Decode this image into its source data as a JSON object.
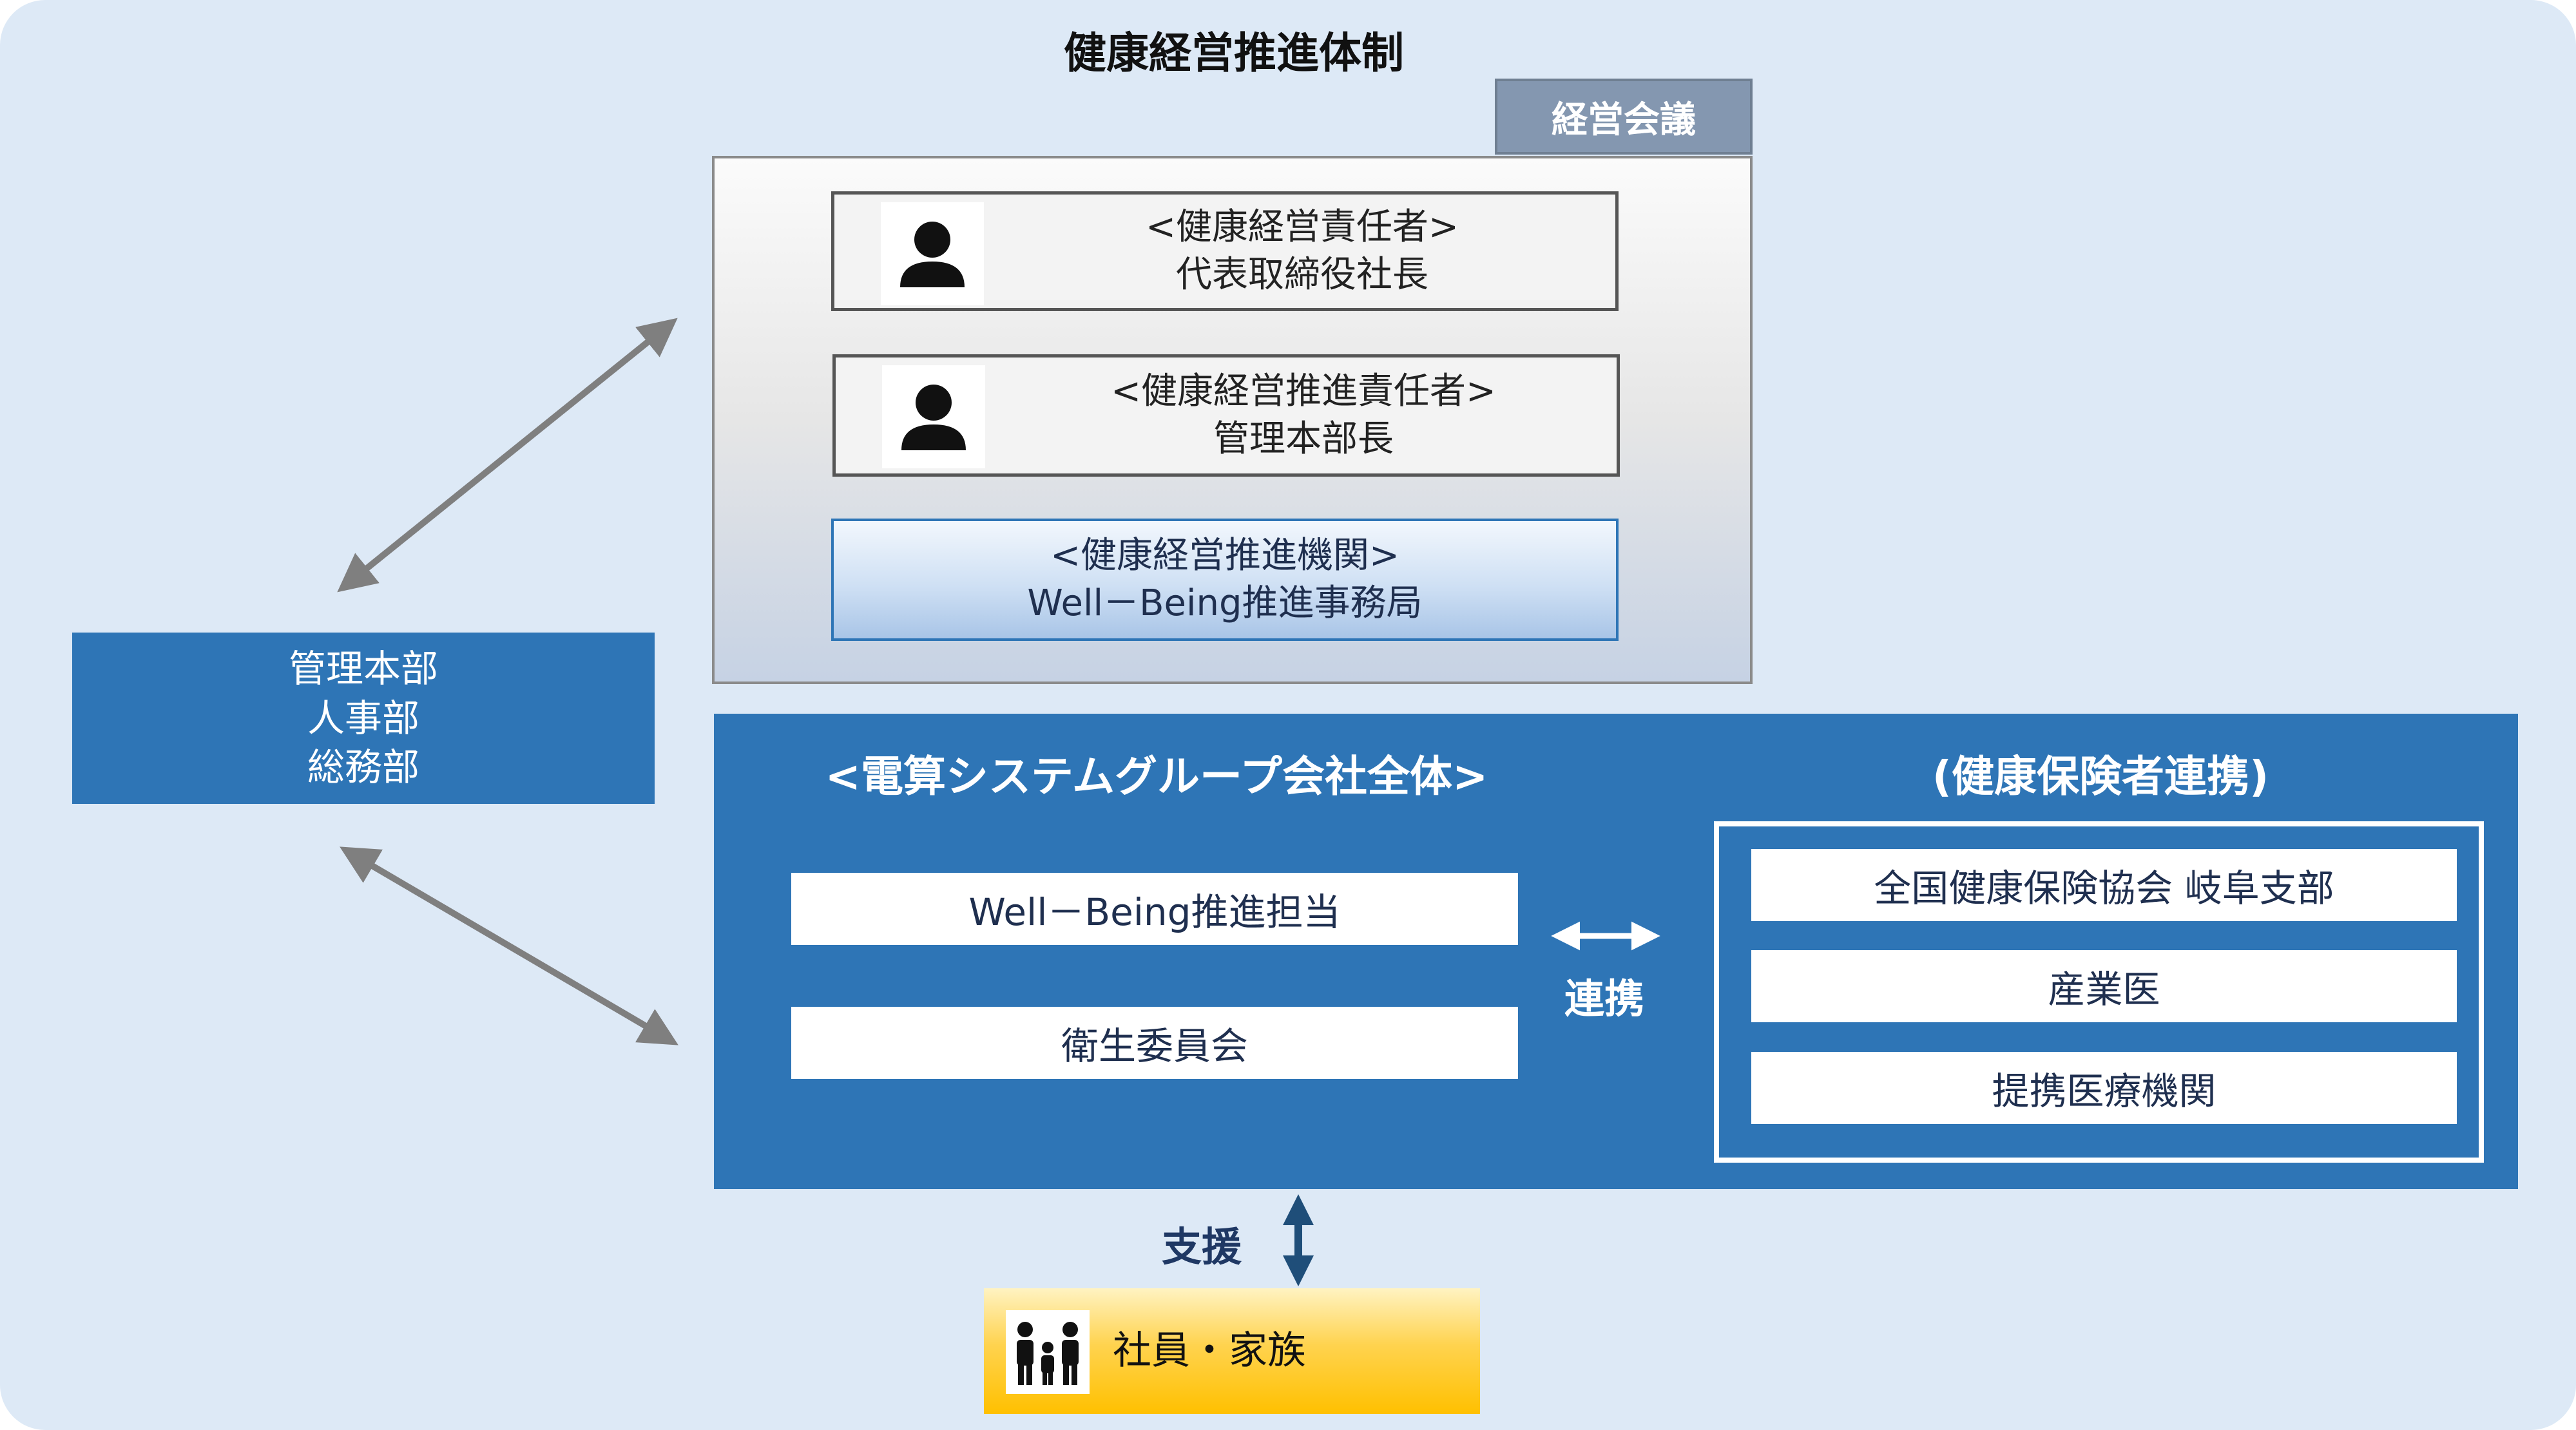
{
  "diagram": {
    "title": "健康経営推進体制",
    "meeting": {
      "label": "経営会議",
      "roles": [
        {
          "heading": "<健康経営責任者>",
          "name": "代表取締役社長",
          "icon": "person-icon"
        },
        {
          "heading": "<健康経営推進責任者>",
          "name": "管理本部長",
          "icon": "person-icon"
        }
      ],
      "promotion": {
        "heading": "<健康経営推進機関>",
        "name": "Well－Being推進事務局"
      }
    },
    "admin": {
      "lines": [
        "管理本部",
        "人事部",
        "総務部"
      ]
    },
    "group": {
      "title": "<電算システムグループ会社全体>",
      "items": [
        "Well－Being推進担当",
        "衛生委員会"
      ]
    },
    "insurer": {
      "title": "(健康保険者連携)",
      "items": [
        "全国健康保険協会 岐阜支部",
        "産業医",
        "提携医療機関"
      ]
    },
    "cooperation_label": "連携",
    "support_label": "支援",
    "family": {
      "label": "社員・家族",
      "icon": "family-icon"
    },
    "colors": {
      "background": "#dde9f6",
      "panel_blue": "#2e75b6",
      "meeting_tab": "#8497b0",
      "arrow_gray": "#7f7f7f",
      "arrow_navy": "#1f4e79",
      "family_gold": "#ffc000"
    }
  }
}
